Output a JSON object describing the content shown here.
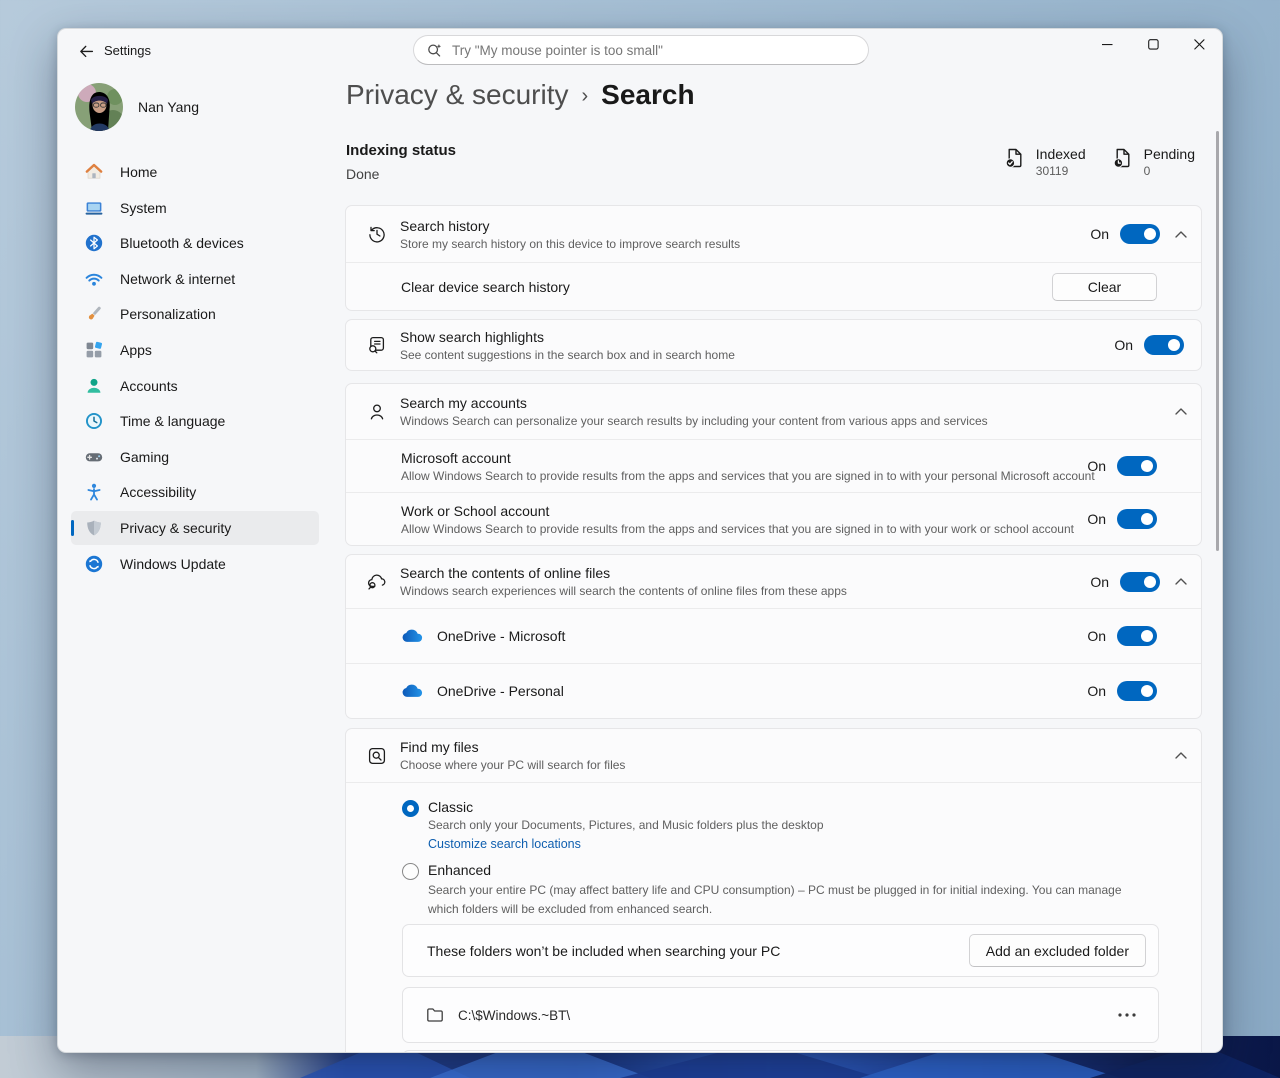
{
  "titlebar": {
    "app_title": "Settings",
    "search_placeholder": "Try \"My mouse pointer is too small\""
  },
  "user": {
    "name": "Nan Yang"
  },
  "sidebar": {
    "items": [
      {
        "label": "Home"
      },
      {
        "label": "System"
      },
      {
        "label": "Bluetooth & devices"
      },
      {
        "label": "Network & internet"
      },
      {
        "label": "Personalization"
      },
      {
        "label": "Apps"
      },
      {
        "label": "Accounts"
      },
      {
        "label": "Time & language"
      },
      {
        "label": "Gaming"
      },
      {
        "label": "Accessibility"
      },
      {
        "label": "Privacy & security",
        "selected": true
      },
      {
        "label": "Windows Update"
      }
    ]
  },
  "breadcrumb": {
    "parent": "Privacy & security",
    "separator": "›",
    "current": "Search"
  },
  "indexing": {
    "title": "Indexing status",
    "status": "Done",
    "stats": [
      {
        "label": "Indexed",
        "value": "30119"
      },
      {
        "label": "Pending",
        "value": "0"
      }
    ]
  },
  "search_history": {
    "title": "Search history",
    "description": "Store my search history on this device to improve search results",
    "state": "On",
    "clear_label": "Clear device search history",
    "clear_button": "Clear"
  },
  "search_highlights": {
    "title": "Show search highlights",
    "description": "See content suggestions in the search box and in search home",
    "state": "On"
  },
  "search_accounts": {
    "title": "Search my accounts",
    "description": "Windows Search can personalize your search results by including your content from various apps and services",
    "rows": [
      {
        "title": "Microsoft account",
        "description": "Allow Windows Search to provide results from the apps and services that you are signed in to with your personal Microsoft account",
        "state": "On"
      },
      {
        "title": "Work or School account",
        "description": "Allow Windows Search to provide results from the apps and services that you are signed in to with your work or school account",
        "state": "On"
      }
    ]
  },
  "online_files": {
    "title": "Search the contents of online files",
    "description": "Windows search experiences will search the contents of online files from these apps",
    "state": "On",
    "rows": [
      {
        "label": "OneDrive - Microsoft",
        "state": "On"
      },
      {
        "label": "OneDrive - Personal",
        "state": "On"
      }
    ]
  },
  "find_my_files": {
    "title": "Find my files",
    "description": "Choose where your PC will search for files",
    "options": [
      {
        "title": "Classic",
        "description": "Search only your Documents, Pictures, and Music folders plus the desktop",
        "link": "Customize search locations",
        "selected": true
      },
      {
        "title": "Enhanced",
        "description": "Search your entire PC (may affect battery life and CPU consumption) – PC must be plugged in for initial indexing. You can manage which folders will be excluded from enhanced search.",
        "selected": false
      }
    ],
    "excluded_folders": {
      "label": "These folders won’t be included when searching your PC",
      "button": "Add an excluded folder",
      "folders": [
        {
          "path": "C:\\$Windows.~BT\\"
        }
      ]
    }
  },
  "colors": {
    "accent": "#0067C0",
    "link": "#0F5FAF"
  }
}
